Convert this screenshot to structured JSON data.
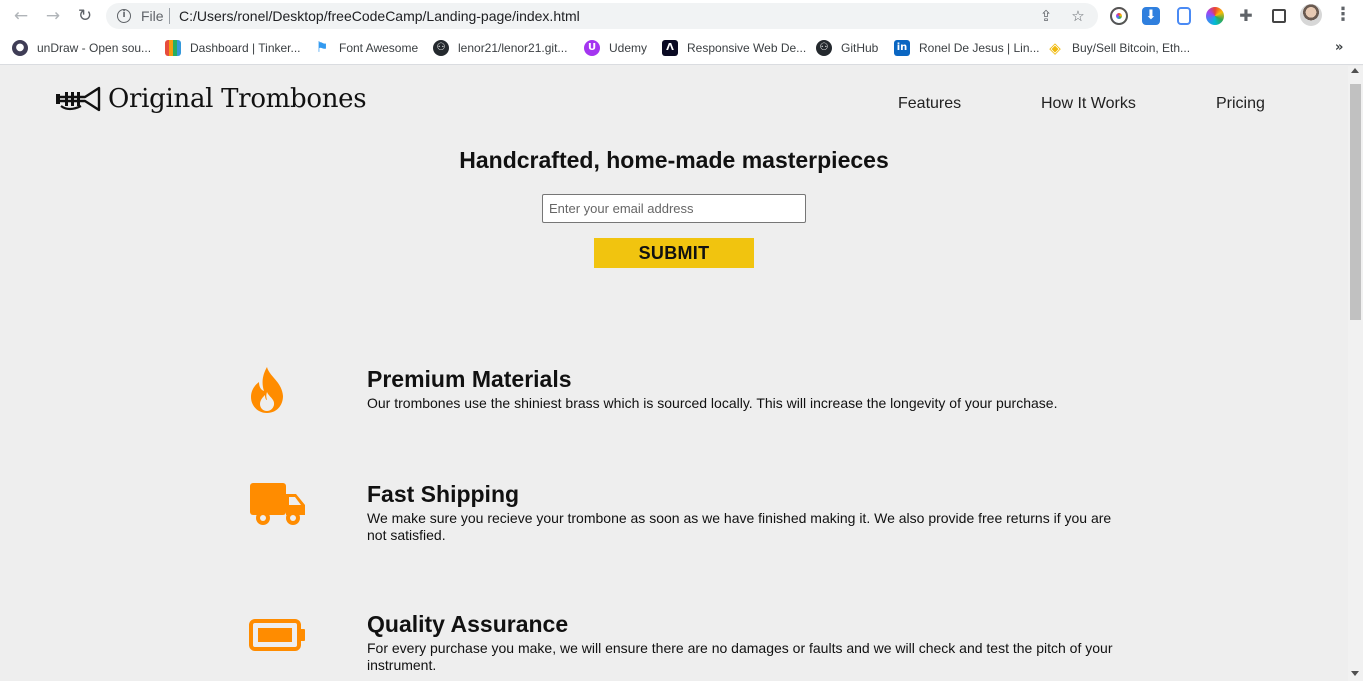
{
  "browser": {
    "file_label": "File",
    "url": "C:/Users/ronel/Desktop/freeCodeCamp/Landing-page/index.html",
    "bookmarks": [
      {
        "label": "unDraw - Open sou...",
        "icon": "undraw-icon",
        "color": "#3f3d56"
      },
      {
        "label": "Dashboard | Tinker...",
        "icon": "tinkercad-icon",
        "color": "#e74c3c"
      },
      {
        "label": "Font Awesome",
        "icon": "flag-icon",
        "color": "#339af0"
      },
      {
        "label": "lenor21/lenor21.git...",
        "icon": "github-icon",
        "color": "#24292e"
      },
      {
        "label": "Udemy",
        "icon": "udemy-icon",
        "color": "#a435f0"
      },
      {
        "label": "Responsive Web De...",
        "icon": "freecodecamp-icon",
        "color": "#0a0a23"
      },
      {
        "label": "GitHub",
        "icon": "github-icon",
        "color": "#24292e"
      },
      {
        "label": "Ronel De Jesus | Lin...",
        "icon": "linkedin-icon",
        "color": "#0a66c2"
      },
      {
        "label": "Buy/Sell Bitcoin, Eth...",
        "icon": "binance-icon",
        "color": "#f0b90b"
      }
    ],
    "more_label": "»"
  },
  "header": {
    "logo_text": "Original Trombones",
    "nav": [
      {
        "label": "Features"
      },
      {
        "label": "How It Works"
      },
      {
        "label": "Pricing"
      }
    ]
  },
  "hero": {
    "title": "Handcrafted, home-made masterpieces",
    "email_placeholder": "Enter your email address",
    "submit_label": "SUBMIT"
  },
  "features": [
    {
      "icon": "fire-icon",
      "title": "Premium Materials",
      "description": "Our trombones use the shiniest brass which is sourced locally. This will increase the longevity of your purchase."
    },
    {
      "icon": "truck-icon",
      "title": "Fast Shipping",
      "description": "We make sure you recieve your trombone as soon as we have finished making it. We also provide free returns if you are not satisfied."
    },
    {
      "icon": "battery-icon",
      "title": "Quality Assurance",
      "description": "For every purchase you make, we will ensure there are no damages or faults and we will check and test the pitch of your instrument."
    }
  ],
  "colors": {
    "accent": "#f1c40f",
    "icon_orange": "#ff8c00",
    "page_bg": "#eeeeee"
  }
}
